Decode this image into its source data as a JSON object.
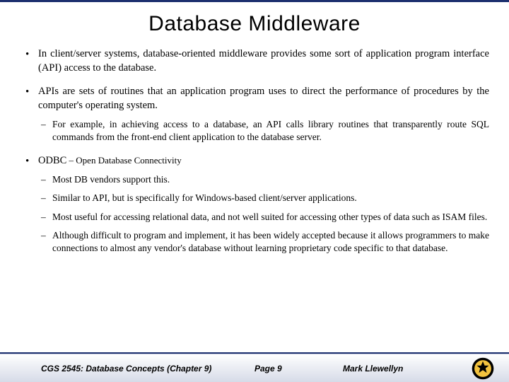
{
  "title": "Database Middleware",
  "bullets": {
    "b1": "In client/server systems, database-oriented middleware provides some sort of application program interface (API) access to the database.",
    "b2": "APIs are sets of routines that an application program uses to direct the performance of procedures by the computer's operating system.",
    "b2_sub1": "For example, in achieving access to a database, an API calls library routines that transparently route SQL commands from the front-end client application to the database server.",
    "b3_lead": "ODBC",
    "b3_tail": " – Open Database Connectivity",
    "b3_sub1": "Most DB vendors support this.",
    "b3_sub2": "Similar to API, but is specifically for Windows-based client/server applications.",
    "b3_sub3": "Most useful for accessing relational data, and not well suited for accessing other types of data such as ISAM files.",
    "b3_sub4": "Although difficult to program and implement, it has been widely accepted because it allows programmers to make connections to almost any vendor's database without learning proprietary code specific to that database."
  },
  "footer": {
    "course": "CGS 2545: Database Concepts  (Chapter 9)",
    "page": "Page 9",
    "author": "Mark Llewellyn"
  }
}
